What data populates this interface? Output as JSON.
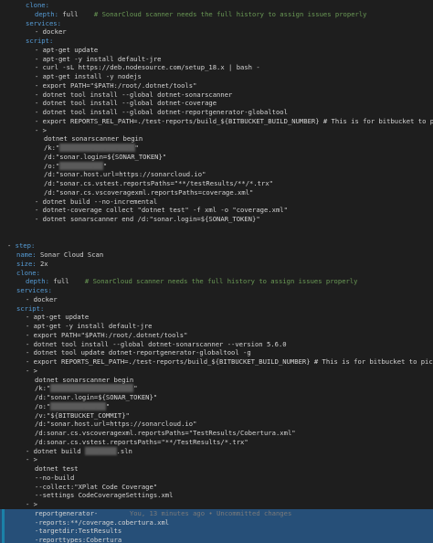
{
  "editor": {
    "lines": [
      {
        "i": 2,
        "t": [
          [
            "tok-key",
            "clone:"
          ]
        ]
      },
      {
        "i": 3,
        "t": [
          [
            "tok-key",
            "depth: "
          ],
          [
            "tok-plain",
            "full    "
          ],
          [
            "tok-comment",
            "# SonarCloud scanner needs the full history to assign issues properly"
          ]
        ]
      },
      {
        "i": 2,
        "t": [
          [
            "tok-key",
            "services:"
          ]
        ]
      },
      {
        "i": 3,
        "t": [
          [
            "tok-plain",
            "- docker"
          ]
        ]
      },
      {
        "i": 2,
        "t": [
          [
            "tok-key",
            "script:"
          ]
        ]
      },
      {
        "i": 3,
        "t": [
          [
            "tok-plain",
            "- apt-get update"
          ]
        ]
      },
      {
        "i": 3,
        "t": [
          [
            "tok-plain",
            "- apt-get -y install default-jre"
          ]
        ]
      },
      {
        "i": 3,
        "t": [
          [
            "tok-plain",
            "- curl -sL https://deb.nodesource.com/setup_18.x | bash -"
          ]
        ]
      },
      {
        "i": 3,
        "t": [
          [
            "tok-plain",
            "- apt-get install -y nodejs"
          ]
        ]
      },
      {
        "i": 3,
        "t": [
          [
            "tok-plain",
            "- export PATH=\"$PATH:/root/.dotnet/tools\""
          ]
        ]
      },
      {
        "i": 3,
        "t": [
          [
            "tok-plain",
            "- dotnet tool install --global dotnet-sonarscanner"
          ]
        ]
      },
      {
        "i": 3,
        "t": [
          [
            "tok-plain",
            "- dotnet tool install --global dotnet-coverage"
          ]
        ]
      },
      {
        "i": 3,
        "t": [
          [
            "tok-plain",
            "- dotnet tool install --global dotnet-reportgenerator-globaltool"
          ]
        ]
      },
      {
        "i": 3,
        "t": [
          [
            "tok-plain",
            "- export REPORTS_REL_PATH=./test-reports/build_${BITBUCKET_BUILD_NUMBER} # This is for bitbucket to pick up the u"
          ]
        ]
      },
      {
        "i": 3,
        "t": [
          [
            "tok-plain",
            "- >"
          ]
        ]
      },
      {
        "i": 4,
        "t": [
          [
            "tok-plain",
            "dotnet sonarscanner begin"
          ]
        ]
      },
      {
        "i": 4,
        "t": [
          [
            "tok-plain",
            "/k:\""
          ],
          [
            "tok-blur",
            "xxxxxxxxxxxxxxxxxxx"
          ],
          [
            "tok-plain",
            "\""
          ]
        ]
      },
      {
        "i": 4,
        "t": [
          [
            "tok-plain",
            "/d:\"sonar.login=${SONAR_TOKEN}\""
          ]
        ]
      },
      {
        "i": 4,
        "t": [
          [
            "tok-plain",
            "/o:\""
          ],
          [
            "tok-blur",
            "xxxxxxxxxxx"
          ],
          [
            "tok-plain",
            "\""
          ]
        ]
      },
      {
        "i": 4,
        "t": [
          [
            "tok-plain",
            "/d:\"sonar.host.url=https://sonarcloud.io\""
          ]
        ]
      },
      {
        "i": 4,
        "t": [
          [
            "tok-plain",
            "/d:\"sonar.cs.vstest.reportsPaths=\"**/testResults/**/*.trx\""
          ]
        ]
      },
      {
        "i": 4,
        "t": [
          [
            "tok-plain",
            "/d:\"sonar.cs.vscoveragexml.reportsPaths=coverage.xml\""
          ]
        ]
      },
      {
        "i": 3,
        "t": [
          [
            "tok-plain",
            "- dotnet build --no-incremental"
          ]
        ]
      },
      {
        "i": 3,
        "t": [
          [
            "tok-plain",
            "- dotnet-coverage collect \"dotnet test\" -f xml -o \"coverage.xml\""
          ]
        ]
      },
      {
        "i": 3,
        "t": [
          [
            "tok-plain",
            "- dotnet sonarscanner end /d:\"sonar.login=${SONAR_TOKEN}\""
          ]
        ]
      },
      {
        "i": 0,
        "t": []
      },
      {
        "i": 0,
        "t": []
      },
      {
        "i": 0,
        "t": [
          [
            "tok-plain",
            "- "
          ],
          [
            "tok-key",
            "step:"
          ]
        ]
      },
      {
        "i": 1,
        "t": [
          [
            "tok-key",
            "name: "
          ],
          [
            "tok-plain",
            "Sonar Cloud Scan"
          ]
        ]
      },
      {
        "i": 1,
        "t": [
          [
            "tok-key",
            "size: "
          ],
          [
            "tok-plain",
            "2x"
          ]
        ]
      },
      {
        "i": 1,
        "t": [
          [
            "tok-key",
            "clone:"
          ]
        ]
      },
      {
        "i": 2,
        "t": [
          [
            "tok-key",
            "depth: "
          ],
          [
            "tok-plain",
            "full    "
          ],
          [
            "tok-comment",
            "# SonarCloud scanner needs the full history to assign issues properly"
          ]
        ]
      },
      {
        "i": 1,
        "t": [
          [
            "tok-key",
            "services:"
          ]
        ]
      },
      {
        "i": 2,
        "t": [
          [
            "tok-plain",
            "- docker"
          ]
        ]
      },
      {
        "i": 1,
        "t": [
          [
            "tok-key",
            "script:"
          ]
        ]
      },
      {
        "i": 2,
        "t": [
          [
            "tok-plain",
            "- apt-get update"
          ]
        ]
      },
      {
        "i": 2,
        "t": [
          [
            "tok-plain",
            "- apt-get -y install default-jre"
          ]
        ]
      },
      {
        "i": 2,
        "t": [
          [
            "tok-plain",
            "- export PATH=\"$PATH:/root/.dotnet/tools\""
          ]
        ]
      },
      {
        "i": 2,
        "t": [
          [
            "tok-plain",
            "- dotnet tool install --global dotnet-sonarscanner --version 5.6.0"
          ]
        ]
      },
      {
        "i": 2,
        "t": [
          [
            "tok-plain",
            "- dotnet tool update dotnet-reportgenerator-globaltool -g"
          ]
        ]
      },
      {
        "i": 2,
        "t": [
          [
            "tok-plain",
            "- export REPORTS_REL_PATH=./test-reports/build_${BITBUCKET_BUILD_NUMBER} # This is for bitbucket to pick up the uni"
          ]
        ]
      },
      {
        "i": 2,
        "t": [
          [
            "tok-plain",
            "- >"
          ]
        ]
      },
      {
        "i": 3,
        "t": [
          [
            "tok-plain",
            "dotnet sonarscanner begin"
          ]
        ]
      },
      {
        "i": 3,
        "t": [
          [
            "tok-plain",
            "/k:\""
          ],
          [
            "tok-blur",
            "xxxxxxxxxxxxxxxxxxxxx"
          ],
          [
            "tok-plain",
            "\""
          ]
        ]
      },
      {
        "i": 3,
        "t": [
          [
            "tok-plain",
            "/d:\"sonar.login=${SONAR_TOKEN}\""
          ]
        ]
      },
      {
        "i": 3,
        "t": [
          [
            "tok-plain",
            "/o:\""
          ],
          [
            "tok-blur",
            "xxxxxxxxxxxxxx"
          ],
          [
            "tok-plain",
            "\""
          ]
        ]
      },
      {
        "i": 3,
        "t": [
          [
            "tok-plain",
            "/v:\"${BITBUCKET_COMMIT}\""
          ]
        ]
      },
      {
        "i": 3,
        "t": [
          [
            "tok-plain",
            "/d:\"sonar.host.url=https://sonarcloud.io\""
          ]
        ]
      },
      {
        "i": 3,
        "t": [
          [
            "tok-plain",
            "/d:sonar.cs.vscoveragexml.reportsPaths=\"TestResults/Cobertura.xml\""
          ]
        ]
      },
      {
        "i": 3,
        "t": [
          [
            "tok-plain",
            "/d:sonar.cs.vstest.reportsPaths=\"**/TestResults/*.trx\""
          ]
        ]
      },
      {
        "i": 2,
        "t": [
          [
            "tok-plain",
            "- dotnet build "
          ],
          [
            "tok-blur",
            "xxxxxxxx"
          ],
          [
            "tok-plain",
            ".sln"
          ]
        ]
      },
      {
        "i": 2,
        "t": [
          [
            "tok-plain",
            "- >"
          ]
        ]
      },
      {
        "i": 3,
        "t": [
          [
            "tok-plain",
            "dotnet test"
          ]
        ]
      },
      {
        "i": 3,
        "t": [
          [
            "tok-plain",
            "--no-build"
          ]
        ]
      },
      {
        "i": 3,
        "t": [
          [
            "tok-plain",
            "--collect:\"XPlat Code Coverage\""
          ]
        ]
      },
      {
        "i": 3,
        "t": [
          [
            "tok-plain",
            "--settings CodeCoverageSettings.xml"
          ]
        ]
      },
      {
        "i": 2,
        "t": [
          [
            "tok-plain",
            "- >"
          ]
        ]
      },
      {
        "i": 3,
        "hl": true,
        "t": [
          [
            "tok-plain",
            "reportgenerator-"
          ],
          [
            "tok-blame",
            "        You, 13 minutes ago • Uncommitted changes"
          ]
        ]
      },
      {
        "i": 3,
        "hl": true,
        "t": [
          [
            "tok-plain",
            "-reports:**/coverage.cobertura.xml"
          ]
        ]
      },
      {
        "i": 3,
        "hl": true,
        "t": [
          [
            "tok-plain",
            "-targetdir:TestResults"
          ]
        ]
      },
      {
        "i": 3,
        "hl": true,
        "t": [
          [
            "tok-plain",
            "-reporttypes:Cobertura"
          ]
        ]
      },
      {
        "i": 2,
        "t": [
          [
            "tok-plain",
            "- dotnet sonarscanner end /d:\"sonar.login=${SONAR_TOKEN}\""
          ]
        ]
      }
    ]
  }
}
